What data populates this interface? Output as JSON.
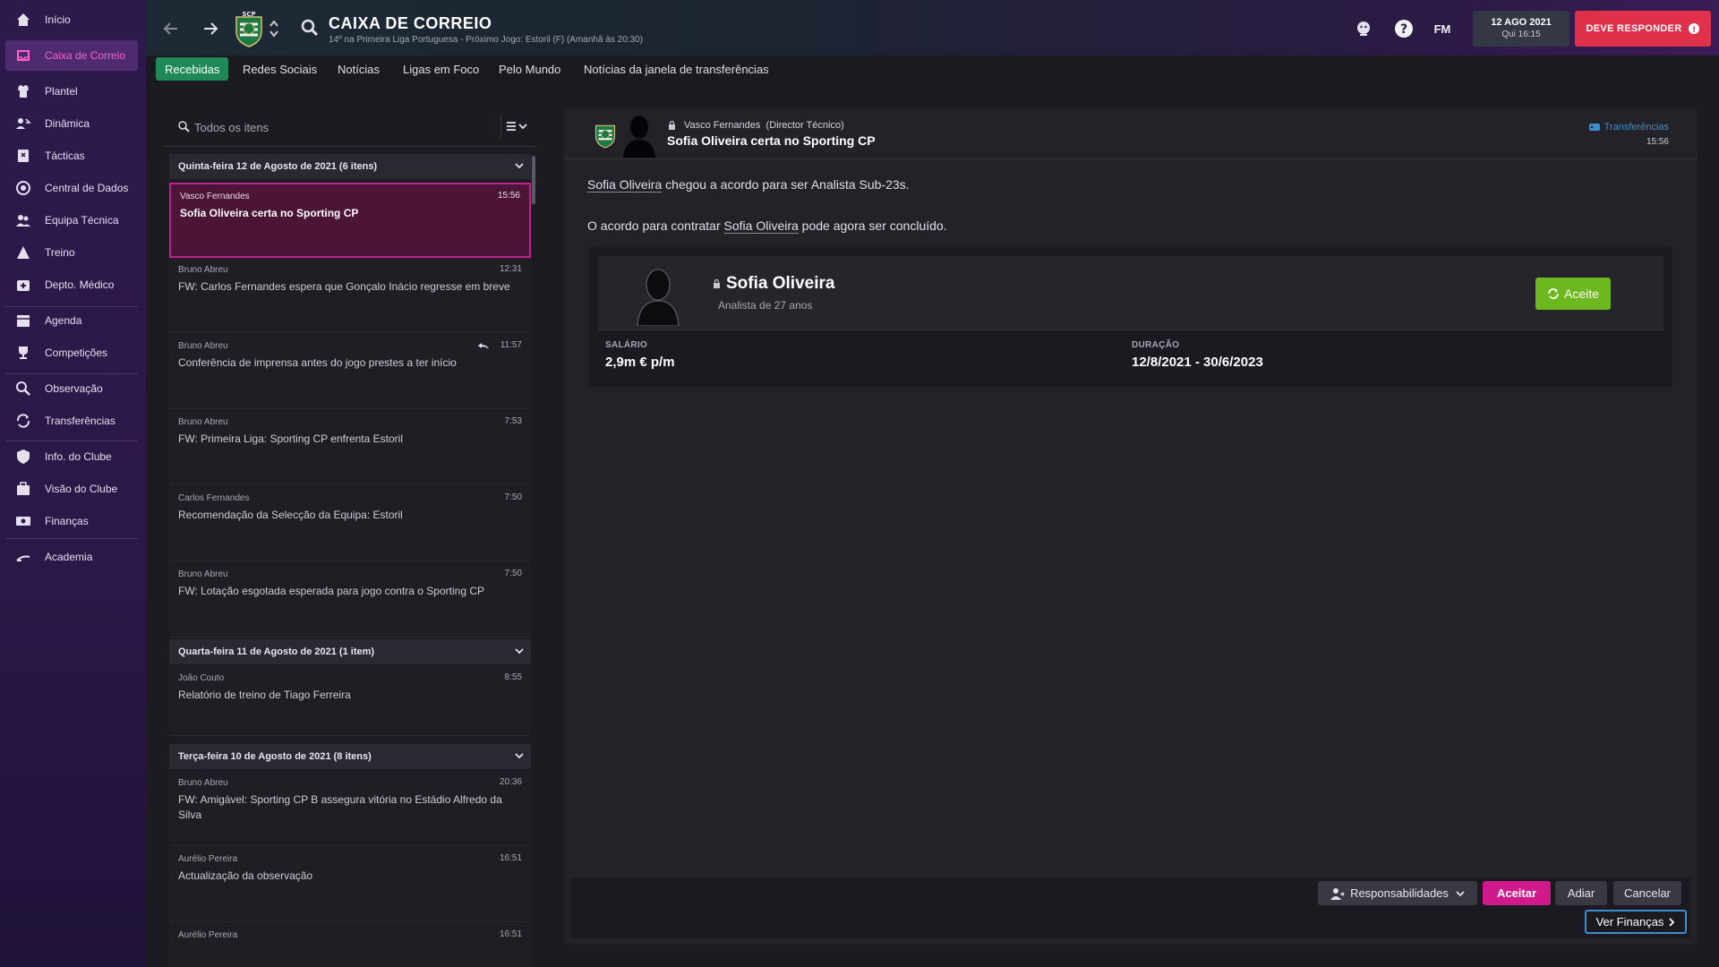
{
  "sidebar": {
    "items": [
      {
        "label": "Início",
        "icon": "home-icon"
      },
      {
        "label": "Caixa de Correio",
        "icon": "inbox-icon"
      },
      {
        "label": "Plantel",
        "icon": "squad-icon"
      },
      {
        "label": "Dinâmica",
        "icon": "dynamics-icon"
      },
      {
        "label": "Tácticas",
        "icon": "tactics-icon"
      },
      {
        "label": "Central de Dados",
        "icon": "data-hub-icon"
      },
      {
        "label": "Equipa Técnica",
        "icon": "staff-icon"
      },
      {
        "label": "Treino",
        "icon": "training-icon"
      },
      {
        "label": "Depto. Médico",
        "icon": "medical-icon"
      },
      {
        "label": "Agenda",
        "icon": "calendar-icon"
      },
      {
        "label": "Competições",
        "icon": "trophy-icon"
      },
      {
        "label": "Observação",
        "icon": "scouting-icon"
      },
      {
        "label": "Transferências",
        "icon": "transfers-icon"
      },
      {
        "label": "Info. do Clube",
        "icon": "club-info-icon"
      },
      {
        "label": "Visão do Clube",
        "icon": "club-vision-icon"
      },
      {
        "label": "Finanças",
        "icon": "finances-icon"
      },
      {
        "label": "Academia",
        "icon": "academy-icon"
      }
    ]
  },
  "header": {
    "title": "CAIXA DE CORREIO",
    "subtitle": "14º na Primeira Liga Portuguesa - Próximo Jogo: Estoril (F) (Amanhã às 20:30)",
    "club_badge_text": "SCP",
    "fm_label": "FM",
    "date": "12 AGO 2021",
    "day_time": "Qui 16:15",
    "respond_label": "DEVE RESPONDER",
    "respond_icon": "!"
  },
  "tabs": [
    {
      "label": "Recebidas",
      "active": true
    },
    {
      "label": "Redes Sociais"
    },
    {
      "label": "Notícias"
    },
    {
      "label": "Ligas em Foco"
    },
    {
      "label": "Pelo Mundo"
    },
    {
      "label": "Notícias da janela de transferências"
    }
  ],
  "inbox": {
    "search_placeholder": "Todos os itens",
    "groups": [
      {
        "label": "Quinta-feira 12 de Agosto de 2021 (6 itens)"
      },
      {
        "label": "Quarta-feira 11 de Agosto de 2021 (1 item)"
      },
      {
        "label": "Terça-feira 10 de Agosto de 2021 (8 itens)"
      }
    ],
    "messages": [
      {
        "sender": "Vasco Fernandes",
        "time": "15:56",
        "subject": "Sofia Oliveira certa no Sporting CP",
        "selected": true
      },
      {
        "sender": "Bruno Abreu",
        "time": "12:31",
        "subject": "FW: Carlos Fernandes espera que Gonçalo Inácio regresse em breve"
      },
      {
        "sender": "Bruno Abreu",
        "time": "11:57",
        "subject": "Conferência de imprensa antes do jogo prestes a ter início"
      },
      {
        "sender": "Bruno Abreu",
        "time": "7:53",
        "subject": "FW: Primeira Liga: Sporting CP enfrenta Estoril"
      },
      {
        "sender": "Carlos Fernandes",
        "time": "7:50",
        "subject": "Recomendação da Selecção da Equipa: Estoril"
      },
      {
        "sender": "Bruno Abreu",
        "time": "7:50",
        "subject": "FW: Lotação esgotada esperada para jogo contra o Sporting CP"
      },
      {
        "sender": "João Couto",
        "time": "8:55",
        "subject": "Relatório de treino de Tiago Ferreira"
      },
      {
        "sender": "Bruno Abreu",
        "time": "20:36",
        "subject": "FW: Amigável: Sporting CP B assegura vitória no Estádio Alfredo da Silva"
      },
      {
        "sender": "Aurélio Pereira",
        "time": "16:51",
        "subject": "Actualização da observação"
      },
      {
        "sender": "Aurélio Pereira",
        "time": "16:51",
        "subject": ""
      }
    ]
  },
  "message": {
    "sender_name": "Vasco Fernandes",
    "sender_role": "(Director Técnico)",
    "subject": "Sofia Oliveira certa no Sporting CP",
    "category": "Transferências",
    "time": "15:56",
    "p1_link": "Sofia Oliveira",
    "p1_rest": " chegou a acordo para ser Analista Sub-23s.",
    "p2_pre": "O acordo para contratar ",
    "p2_link": "Sofia Oliveira",
    "p2_rest": " pode agora ser concluído.",
    "card": {
      "name": "Sofia Oliveira",
      "role": "Analista de 27 anos",
      "status_label": "Aceite",
      "salary_label": "SALÁRIO",
      "salary_value": "2,9m € p/m",
      "duration_label": "DURAÇÃO",
      "duration_value": "12/8/2021 - 30/6/2023"
    }
  },
  "actions": {
    "responsibilities": "Responsabilidades",
    "accept": "Aceitar",
    "postpone": "Adiar",
    "cancel": "Cancelar",
    "view_finances": "Ver Finanças"
  },
  "colors": {
    "accent_pink": "#d01a8c",
    "tab_green": "#1f8a58",
    "accept_green": "#6db81e",
    "alert_red": "#e0314a",
    "link_blue": "#3e8ed0"
  }
}
